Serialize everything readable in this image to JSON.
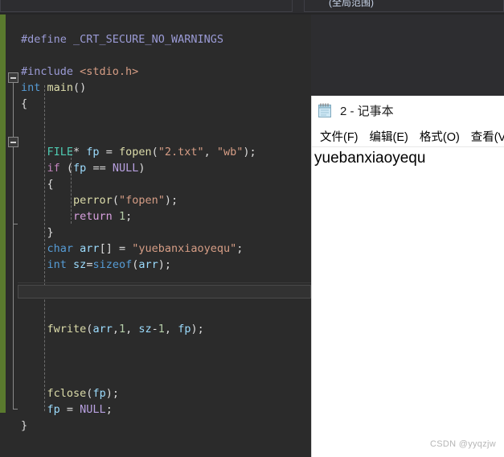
{
  "ide": {
    "scope_dropdown_value": "(全局范围)",
    "chevron_icon": "chevron-down-icon",
    "editor_background": "#2b2b2b",
    "change_margin_color": "#5a7a2e",
    "code_lines": [
      {
        "indent": 0,
        "tokens": []
      },
      {
        "indent": 0,
        "tokens": [
          {
            "t": "#define ",
            "c": "pp"
          },
          {
            "t": "_CRT_SECURE_NO_WARNINGS",
            "c": "ppword"
          }
        ]
      },
      {
        "indent": 0,
        "tokens": []
      },
      {
        "indent": 0,
        "tokens": [
          {
            "t": "#include ",
            "c": "pp"
          },
          {
            "t": "<stdio.h>",
            "c": "hdr"
          }
        ]
      },
      {
        "indent": 0,
        "tokens": [
          {
            "t": "int",
            "c": "kw"
          },
          {
            "t": " ",
            "c": "plain"
          },
          {
            "t": "main",
            "c": "fn"
          },
          {
            "t": "()",
            "c": "punc"
          }
        ]
      },
      {
        "indent": 0,
        "tokens": [
          {
            "t": "{",
            "c": "punc"
          }
        ]
      },
      {
        "indent": 0,
        "tokens": []
      },
      {
        "indent": 0,
        "tokens": []
      },
      {
        "indent": 1,
        "tokens": [
          {
            "t": "FILE",
            "c": "type"
          },
          {
            "t": "* ",
            "c": "punc"
          },
          {
            "t": "fp",
            "c": "ident"
          },
          {
            "t": " = ",
            "c": "punc"
          },
          {
            "t": "fopen",
            "c": "fn"
          },
          {
            "t": "(",
            "c": "punc"
          },
          {
            "t": "\"2.txt\"",
            "c": "str"
          },
          {
            "t": ", ",
            "c": "punc"
          },
          {
            "t": "\"wb\"",
            "c": "str"
          },
          {
            "t": ");",
            "c": "punc"
          }
        ]
      },
      {
        "indent": 1,
        "tokens": [
          {
            "t": "if",
            "c": "macro"
          },
          {
            "t": " (",
            "c": "punc"
          },
          {
            "t": "fp",
            "c": "ident"
          },
          {
            "t": " == ",
            "c": "punc"
          },
          {
            "t": "NULL",
            "c": "nul"
          },
          {
            "t": ")",
            "c": "punc"
          }
        ]
      },
      {
        "indent": 1,
        "tokens": [
          {
            "t": "{",
            "c": "punc"
          }
        ]
      },
      {
        "indent": 2,
        "tokens": [
          {
            "t": "perror",
            "c": "fn"
          },
          {
            "t": "(",
            "c": "punc"
          },
          {
            "t": "\"fopen\"",
            "c": "str"
          },
          {
            "t": ");",
            "c": "punc"
          }
        ]
      },
      {
        "indent": 2,
        "tokens": [
          {
            "t": "return",
            "c": "ret"
          },
          {
            "t": " ",
            "c": "plain"
          },
          {
            "t": "1",
            "c": "num"
          },
          {
            "t": ";",
            "c": "punc"
          }
        ]
      },
      {
        "indent": 1,
        "tokens": [
          {
            "t": "}",
            "c": "punc"
          }
        ]
      },
      {
        "indent": 1,
        "tokens": [
          {
            "t": "char",
            "c": "kw"
          },
          {
            "t": " ",
            "c": "plain"
          },
          {
            "t": "arr",
            "c": "ident"
          },
          {
            "t": "[] = ",
            "c": "punc"
          },
          {
            "t": "\"yuebanxiaoyequ\"",
            "c": "str"
          },
          {
            "t": ";",
            "c": "punc"
          }
        ]
      },
      {
        "indent": 1,
        "tokens": [
          {
            "t": "int",
            "c": "kw"
          },
          {
            "t": " ",
            "c": "plain"
          },
          {
            "t": "sz",
            "c": "ident"
          },
          {
            "t": "=",
            "c": "punc"
          },
          {
            "t": "sizeof",
            "c": "kw"
          },
          {
            "t": "(",
            "c": "punc"
          },
          {
            "t": "arr",
            "c": "ident"
          },
          {
            "t": ");",
            "c": "punc"
          }
        ]
      },
      {
        "indent": 0,
        "tokens": []
      },
      {
        "indent": 0,
        "tokens": []
      },
      {
        "indent": 0,
        "tokens": []
      },
      {
        "indent": 1,
        "tokens": [
          {
            "t": "fwrite",
            "c": "fn"
          },
          {
            "t": "(",
            "c": "punc"
          },
          {
            "t": "arr",
            "c": "ident"
          },
          {
            "t": ",",
            "c": "punc"
          },
          {
            "t": "1",
            "c": "num"
          },
          {
            "t": ", ",
            "c": "punc"
          },
          {
            "t": "sz",
            "c": "ident"
          },
          {
            "t": "-",
            "c": "punc"
          },
          {
            "t": "1",
            "c": "num"
          },
          {
            "t": ", ",
            "c": "punc"
          },
          {
            "t": "fp",
            "c": "ident"
          },
          {
            "t": ");",
            "c": "punc"
          }
        ]
      },
      {
        "indent": 0,
        "tokens": []
      },
      {
        "indent": 0,
        "tokens": []
      },
      {
        "indent": 0,
        "tokens": []
      },
      {
        "indent": 1,
        "tokens": [
          {
            "t": "fclose",
            "c": "fn"
          },
          {
            "t": "(",
            "c": "punc"
          },
          {
            "t": "fp",
            "c": "ident"
          },
          {
            "t": ");",
            "c": "punc"
          }
        ]
      },
      {
        "indent": 1,
        "tokens": [
          {
            "t": "fp",
            "c": "ident"
          },
          {
            "t": " = ",
            "c": "punc"
          },
          {
            "t": "NULL",
            "c": "nul"
          },
          {
            "t": ";",
            "c": "punc"
          }
        ]
      },
      {
        "indent": 0,
        "tokens": [
          {
            "t": "}",
            "c": "punc"
          }
        ]
      }
    ]
  },
  "notepad": {
    "icon": "notepad-icon",
    "title": "2 - 记事本",
    "menu_items": [
      {
        "label": "文件(F)"
      },
      {
        "label": "编辑(E)"
      },
      {
        "label": "格式(O)"
      },
      {
        "label": "查看(V"
      }
    ],
    "document_text": "yuebanxiaoyequ"
  },
  "watermark": {
    "text": "CSDN @yyqzjw"
  }
}
